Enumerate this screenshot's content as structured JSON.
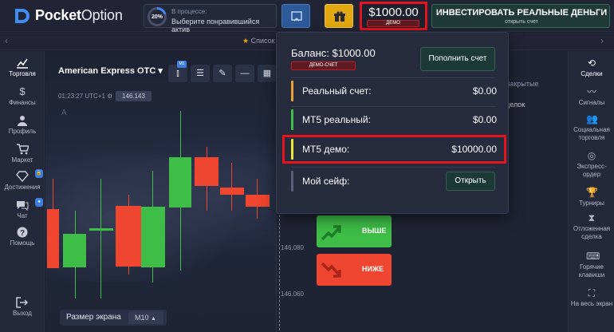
{
  "header": {
    "brand_a": "Pocket",
    "brand_b": "Option",
    "progress_percent": "20%",
    "progress_fraction": 0.2,
    "progress_title": "В процессе:",
    "progress_subtitle": "Выберите понравившийся актив",
    "balance": "$1000.00",
    "balance_tag": "ДЕМО",
    "invest_title": "ИНВЕСТИРОВАТЬ РЕАЛЬНЫЕ ДЕНЬГИ",
    "invest_subtitle": "открыть счет",
    "accent_red": "#e5131d"
  },
  "subbar": {
    "left_arrow": "‹",
    "right_arrow": "›",
    "favorites": "Список"
  },
  "left_nav": [
    {
      "label": "Торговля",
      "icon": "chart-line-icon"
    },
    {
      "label": "Финансы",
      "icon": "dollar-icon"
    },
    {
      "label": "Профиль",
      "icon": "user-icon"
    },
    {
      "label": "Маркет",
      "icon": "cart-icon"
    },
    {
      "label": "Достижения",
      "icon": "diamond-icon"
    },
    {
      "label": "Чат",
      "icon": "chat-icon"
    },
    {
      "label": "Помощь",
      "icon": "help-icon"
    },
    {
      "label": "Выход",
      "icon": "logout-icon"
    }
  ],
  "chart": {
    "asset": "American Express OTC",
    "timeframe_badge": "M1",
    "time": "01:23:27  UTC+1",
    "price_top": "146.143",
    "a_label": "A",
    "axis_1": "146.080",
    "axis_2": "146.060",
    "screen_size_label": "Размер экрана",
    "screen_size_value": "M10",
    "up_color": "#3ebd47",
    "down_color": "#ee4630"
  },
  "mid": {
    "closed_tab": "Закрытые",
    "deals": "делок",
    "up_label": "ВЫШЕ",
    "down_label": "НИЖЕ"
  },
  "right_nav": [
    {
      "label": "Сделки",
      "icon": "history-icon"
    },
    {
      "label": "Сигналы",
      "icon": "signal-icon"
    },
    {
      "label": "Социальная торговля",
      "icon": "social-icon"
    },
    {
      "label": "Экспресс-ордер",
      "icon": "express-icon"
    },
    {
      "label": "Турниры",
      "icon": "trophy-icon"
    },
    {
      "label": "Отложенная сделка",
      "icon": "hourglass-icon"
    },
    {
      "label": "Горячие клавиши",
      "icon": "keyboard-icon"
    },
    {
      "label": "На весь экран",
      "icon": "fullscreen-icon"
    }
  ],
  "balance_dropdown": {
    "balance_line": "Баланс: $1000.00",
    "tag": "ДЕМО-СЧЕТ",
    "top_up": "Пополнить счет",
    "accounts": [
      {
        "name": "Реальный счет:",
        "value": "$0.00",
        "color": "#e9a33a"
      },
      {
        "name": "МТ5 реальный:",
        "value": "$0.00",
        "color": "#3ebd47"
      },
      {
        "name": "МТ5 демо:",
        "value": "$10000.00",
        "color": "#e8e83a"
      },
      {
        "name": "Мой сейф:",
        "value": "",
        "color": "#5a6078"
      }
    ],
    "open": "Открыть"
  }
}
